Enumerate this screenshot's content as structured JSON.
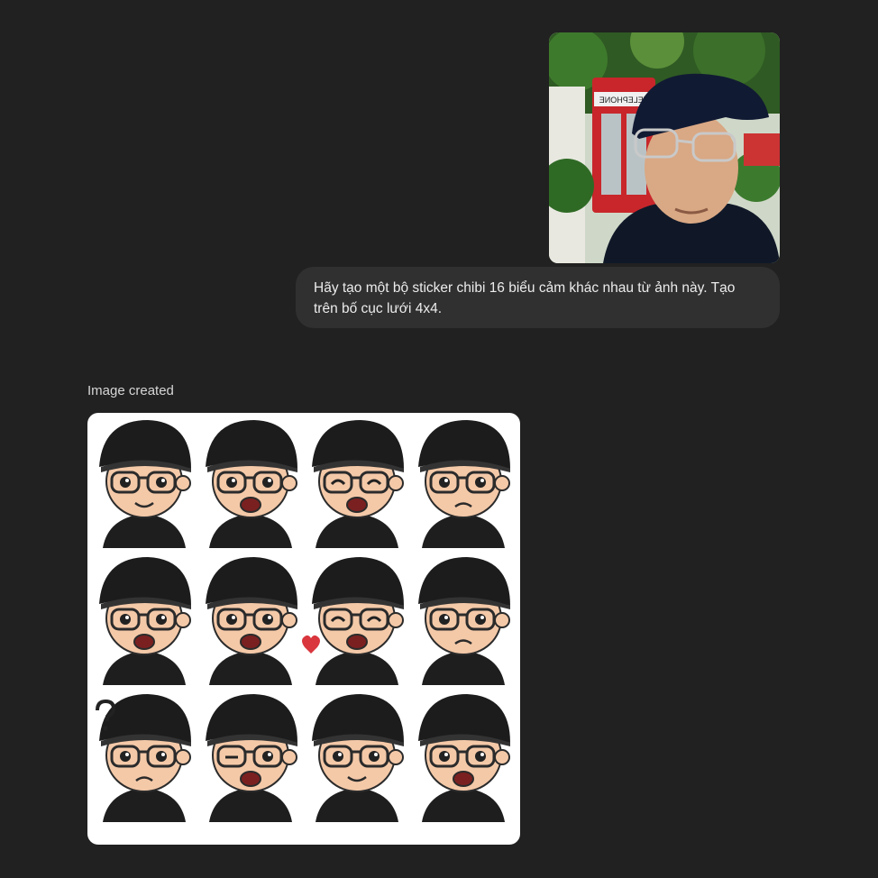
{
  "conversation": {
    "user_message": {
      "text": "Hãy tạo một bộ sticker chibi 16 biểu cảm khác nhau từ ảnh này. Tạo trên bố cục lưới 4x4."
    },
    "assistant_message": {
      "status_label": "Image created"
    }
  },
  "user_photo": {
    "sign_text": "TELEPHONE"
  },
  "stickers": [
    {
      "expression": "neutral"
    },
    {
      "expression": "angry"
    },
    {
      "expression": "laughing"
    },
    {
      "expression": "worried"
    },
    {
      "expression": "surprised"
    },
    {
      "expression": "shouting"
    },
    {
      "expression": "love"
    },
    {
      "expression": "nervous"
    },
    {
      "expression": "confused"
    },
    {
      "expression": "wink"
    },
    {
      "expression": "smile"
    },
    {
      "expression": "determined"
    }
  ],
  "colors": {
    "background": "#212121",
    "bubble": "#303030",
    "text": "#ececec",
    "cap": "#1c1c1c",
    "skin": "#f4c9a8",
    "shirt": "#1e1e1e",
    "heart": "#d9363e"
  }
}
